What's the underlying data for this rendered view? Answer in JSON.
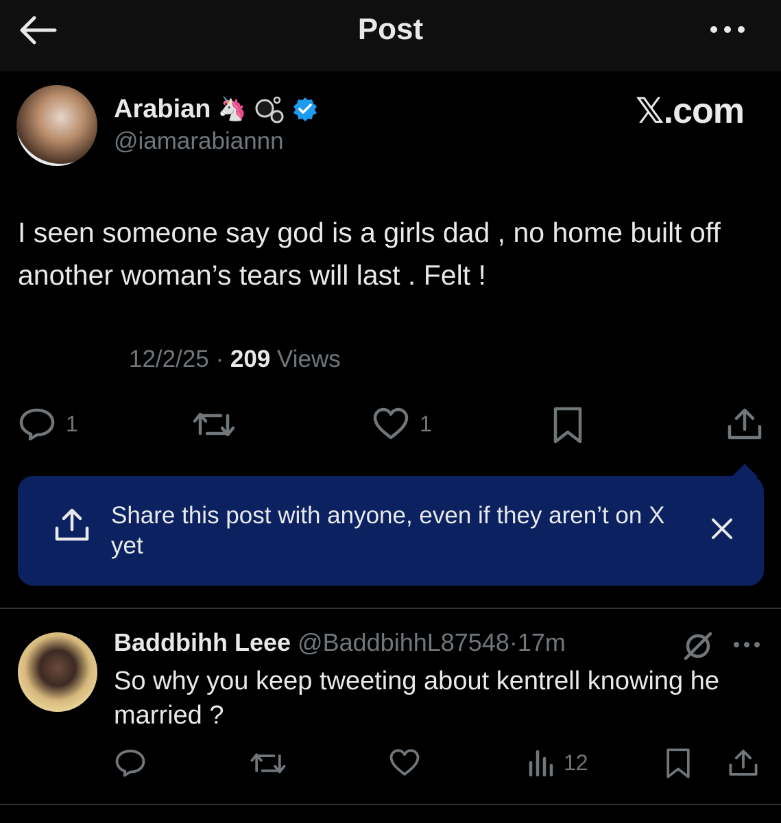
{
  "header": {
    "title": "Post"
  },
  "post": {
    "author_name": "Arabian",
    "author_emojis": "🦄",
    "author_handle": "@iamarabiannn",
    "brand": "𝕏.com",
    "text": "I seen someone say god is a girls dad , no home built off another woman’s tears will last . Felt !",
    "date": "12/2/25",
    "separator": "·",
    "views_count": "209",
    "views_label": "Views",
    "actions": {
      "reply_count": "1",
      "like_count": "1"
    }
  },
  "share_banner": {
    "text": "Share this post with anyone, even if they aren’t on X yet",
    "accent_color": "#0b2160"
  },
  "reply": {
    "author_name": "Baddbihh Leee",
    "author_handle": "@BaddbihhL87548",
    "separator": "·",
    "time": "17m",
    "text": "So why you keep tweeting about kentrell knowing he married ?",
    "views_count": "12"
  },
  "colors": {
    "background": "#000000",
    "text": "#e7e9ea",
    "muted": "#71767b",
    "verified": "#1d9bf0"
  },
  "icons": [
    "back-arrow-icon",
    "more-icon",
    "verified-badge-icon",
    "reply-icon",
    "repost-icon",
    "like-icon",
    "bookmark-icon",
    "share-icon",
    "close-icon",
    "grok-icon",
    "views-icon"
  ]
}
